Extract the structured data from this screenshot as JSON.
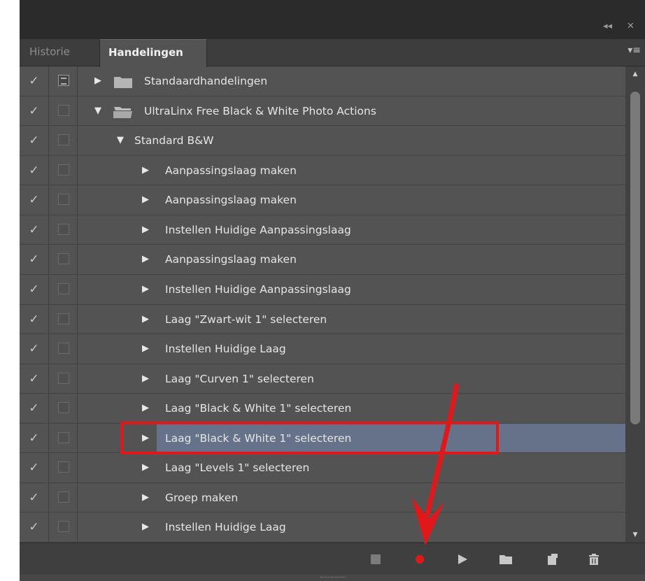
{
  "window": {
    "collapse_glyph": "◂◂",
    "close_glyph": "✕"
  },
  "tabs": [
    {
      "label": "Historie",
      "active": false
    },
    {
      "label": "Handelingen",
      "active": true
    }
  ],
  "panel_menu_glyph": "▾≡",
  "rows": [
    {
      "checked": true,
      "dialog": true,
      "expanded": false,
      "folder": true,
      "label": "Standaardhandelingen"
    },
    {
      "checked": true,
      "dialog": false,
      "expanded": true,
      "folder": true,
      "label": "UltraLinx Free Black & White Photo Actions"
    },
    {
      "checked": true,
      "dialog": false,
      "expanded": true,
      "folder": false,
      "label": "Standard B&W"
    },
    {
      "checked": true,
      "dialog": false,
      "expanded": false,
      "label": "Aanpassingslaag maken"
    },
    {
      "checked": true,
      "dialog": false,
      "expanded": false,
      "label": "Aanpassingslaag maken"
    },
    {
      "checked": true,
      "dialog": false,
      "expanded": false,
      "label": "Instellen  Huidige Aanpassingslaag"
    },
    {
      "checked": true,
      "dialog": false,
      "expanded": false,
      "label": "Aanpassingslaag maken"
    },
    {
      "checked": true,
      "dialog": false,
      "expanded": false,
      "label": "Instellen  Huidige Aanpassingslaag"
    },
    {
      "checked": true,
      "dialog": false,
      "expanded": false,
      "label": "Laag \"Zwart-wit 1\" selecteren"
    },
    {
      "checked": true,
      "dialog": false,
      "expanded": false,
      "label": "Instellen  Huidige Laag"
    },
    {
      "checked": true,
      "dialog": false,
      "expanded": false,
      "label": "Laag \"Curven 1\" selecteren"
    },
    {
      "checked": true,
      "dialog": false,
      "expanded": false,
      "label": "Laag \"Black & White 1\" selecteren"
    },
    {
      "checked": true,
      "dialog": false,
      "expanded": false,
      "selected": true,
      "label": "Laag \"Black & White 1\" selecteren"
    },
    {
      "checked": true,
      "dialog": false,
      "expanded": false,
      "label": "Laag \"Levels 1\" selecteren"
    },
    {
      "checked": true,
      "dialog": false,
      "expanded": false,
      "label": "Groep maken"
    },
    {
      "checked": true,
      "dialog": false,
      "expanded": false,
      "label": "Instellen  Huidige Laag"
    }
  ],
  "glyphs": {
    "check": "✓",
    "collapsed": "▶",
    "expanded": "▼",
    "scroll_up": "▲",
    "scroll_down": "▼"
  },
  "toolbar": {
    "buttons": [
      {
        "name": "stop-playing-button",
        "icon": "stop-icon"
      },
      {
        "name": "record-button",
        "icon": "record-icon",
        "color": "#e01818"
      },
      {
        "name": "play-selection-button",
        "icon": "play-icon"
      },
      {
        "name": "new-set-button",
        "icon": "folder-icon"
      },
      {
        "name": "new-action-button",
        "icon": "new-page-icon"
      },
      {
        "name": "delete-button",
        "icon": "trash-icon"
      }
    ]
  },
  "colors": {
    "panel_bg": "#535353",
    "selected_row": "#667289",
    "annotation_red": "#e1181a",
    "record_red": "#e01818"
  }
}
